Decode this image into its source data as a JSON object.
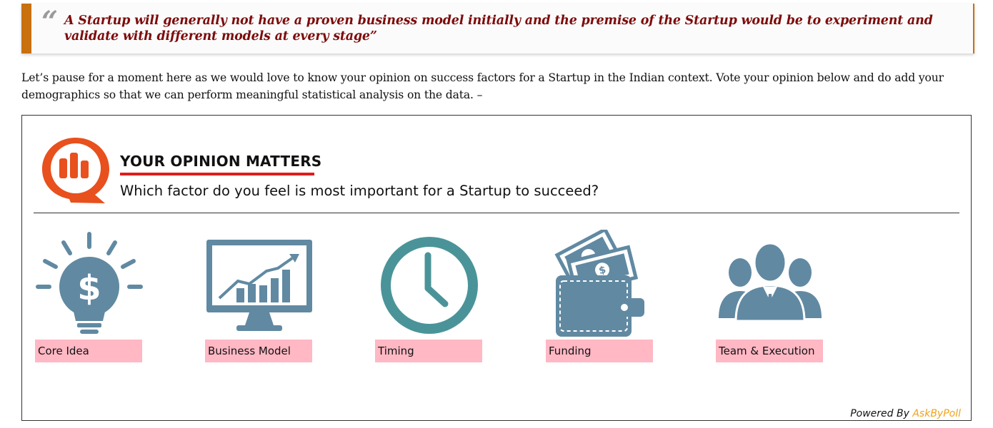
{
  "quote": {
    "mark": "“",
    "text": "A Startup will generally not have a proven business model initially and the premise of the Startup would be to experiment and validate with different models at every stage”"
  },
  "intro": "Let’s pause for a moment here as we would love to know your opinion on success factors for a Startup in the Indian context. Vote your opinion below and do add your demographics so that we can perform meaningful statistical analysis on the data. –",
  "poll": {
    "logo_icon": "poll-chat-bubble-icon",
    "heading": "YOUR OPINION MATTERS",
    "question": "Which factor do you feel is most important for a Startup to succeed?",
    "options": [
      {
        "label": "Core Idea",
        "icon": "lightbulb-dollar-icon"
      },
      {
        "label": "Business Model",
        "icon": "monitor-chart-icon"
      },
      {
        "label": "Timing",
        "icon": "clock-icon"
      },
      {
        "label": "Funding",
        "icon": "wallet-money-icon"
      },
      {
        "label": "Team & Execution",
        "icon": "team-people-icon"
      }
    ],
    "powered_by": "Powered By",
    "brand": "AskByPoll"
  },
  "colors": {
    "quote_accent": "#c9700f",
    "quote_text": "#7d0b0b",
    "underline": "#e21b1b",
    "icon_blue": "#6189a2",
    "icon_teal": "#4a9499",
    "label_bg": "#ffb8c4",
    "brand": "#f0a21a",
    "logo": "#e8501d"
  }
}
